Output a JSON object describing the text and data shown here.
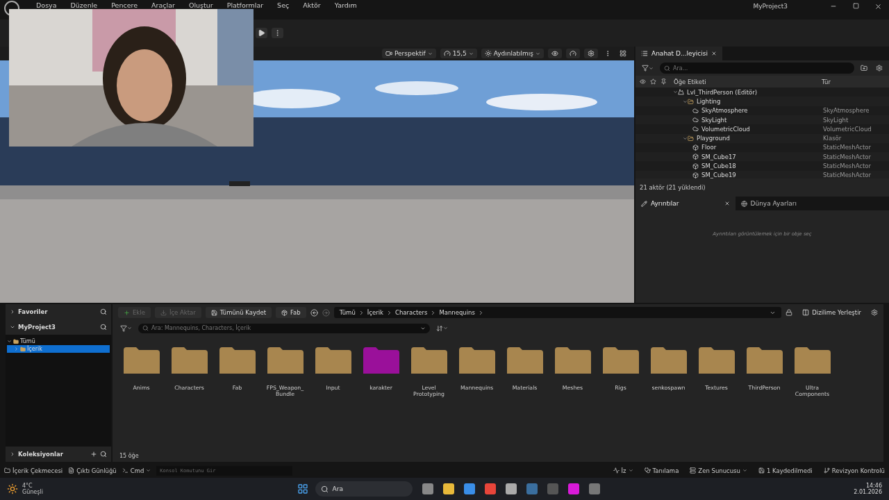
{
  "menu_bar": {
    "items": [
      "Dosya",
      "Düzenle",
      "Pencere",
      "Araçlar",
      "Oluştur",
      "Platformlar",
      "Seç",
      "Aktör",
      "Yardım"
    ],
    "project": "MyProject3"
  },
  "viewport": {
    "toolbar": [
      {
        "kind": "camera",
        "label": "Perspektif"
      },
      {
        "kind": "speed",
        "label": "15,5"
      },
      {
        "kind": "lit",
        "label": "Aydınlatılmış"
      }
    ]
  },
  "outliner": {
    "tab": {
      "label": "Anahat D...leyicisi",
      "selected": true
    },
    "search": {
      "placeholder": "Ara..."
    },
    "columns": [
      "Öğe Etiketi",
      "Tür"
    ],
    "tree": [
      {
        "label": "Lvl_ThirdPerson (Editör)",
        "kind": "level",
        "expanded": true,
        "children": [
          {
            "label": "Lighting",
            "kind": "folder",
            "expanded": true,
            "children": [
              {
                "label": "SkyAtmosphere",
                "kind": "actor",
                "type": "SkyAtmosphere"
              },
              {
                "label": "SkyLight",
                "kind": "actor",
                "type": "SkyLight"
              },
              {
                "label": "VolumetricCloud",
                "kind": "actor",
                "type": "VolumetricCloud"
              }
            ]
          },
          {
            "label": "Playground",
            "kind": "folder",
            "type": "Klasör",
            "expanded": true,
            "children": [
              {
                "label": "Floor",
                "kind": "mesh",
                "type": "StaticMeshActor"
              },
              {
                "label": "SM_Cube17",
                "kind": "mesh",
                "type": "StaticMeshActor"
              },
              {
                "label": "SM_Cube18",
                "kind": "mesh",
                "type": "StaticMeshActor"
              },
              {
                "label": "SM_Cube19",
                "kind": "mesh",
                "type": "StaticMeshActor"
              }
            ]
          }
        ]
      }
    ],
    "footer": "21 aktör (21 yüklendi)"
  },
  "details": {
    "tabs": [
      {
        "label": "Ayrıntılar",
        "selected": true
      },
      {
        "label": "Dünya Ayarları",
        "selected": false
      }
    ],
    "empty_message": "Ayrıntıları görüntülemek için bir obje seç"
  },
  "content_browser": {
    "sidebar": {
      "favorites": "Favoriler",
      "project": "MyProject3",
      "tree": [
        {
          "label": "Tümü",
          "selected": false,
          "children": [
            {
              "label": "İçerik",
              "selected": true
            }
          ]
        }
      ],
      "collections": "Koleksiyonlar"
    },
    "actions": [
      {
        "label": "Ekle",
        "kind": "add",
        "disabled": true
      },
      {
        "label": "İçe Aktar",
        "kind": "import",
        "disabled": true
      },
      {
        "label": "Tümünü Kaydet",
        "kind": "save",
        "disabled": false
      },
      {
        "label": "Fab",
        "kind": "fab",
        "disabled": false
      }
    ],
    "breadcrumb": [
      "Tümü",
      "İçerik",
      "Characters",
      "Mannequins"
    ],
    "dock_button": "Dizilime Yerleştir",
    "search": {
      "placeholder": "Ara: Mannequins, Characters, İçerik"
    },
    "folders": [
      {
        "name": "Anims",
        "color": "#a8864f"
      },
      {
        "name": "Characters",
        "color": "#a8864f"
      },
      {
        "name": "Fab",
        "color": "#a8864f"
      },
      {
        "name": "FPS_Weapon_ Bundle",
        "color": "#a8864f"
      },
      {
        "name": "Input",
        "color": "#a8864f"
      },
      {
        "name": "karakter",
        "color": "#9a109a"
      },
      {
        "name": "Level Prototyping",
        "color": "#a8864f"
      },
      {
        "name": "Mannequins",
        "color": "#a8864f"
      },
      {
        "name": "Materials",
        "color": "#a8864f"
      },
      {
        "name": "Meshes",
        "color": "#a8864f"
      },
      {
        "name": "Rigs",
        "color": "#a8864f"
      },
      {
        "name": "senkospawn",
        "color": "#a8864f"
      },
      {
        "name": "Textures",
        "color": "#a8864f"
      },
      {
        "name": "ThirdPerson",
        "color": "#a8864f"
      },
      {
        "name": "Ultra Components",
        "color": "#a8864f"
      }
    ],
    "count": "15 öğe"
  },
  "status_bar": {
    "left": [
      {
        "label": "İçerik Çekmecesi",
        "kind": "drawer"
      },
      {
        "label": "Çıktı Günlüğü",
        "kind": "log"
      },
      {
        "label": "Cmd",
        "kind": "cmd"
      }
    ],
    "console": {
      "placeholder": "Konsol Komutunu Gir"
    },
    "right": [
      {
        "label": "İz",
        "kind": "trace"
      },
      {
        "label": "Tanılama",
        "kind": "diag"
      },
      {
        "label": "Zen Sunucusu",
        "kind": "zen"
      },
      {
        "label": "1 Kaydedilmedi",
        "kind": "unsaved"
      },
      {
        "label": "Revizyon Kontrolü",
        "kind": "rev"
      }
    ]
  },
  "taskbar": {
    "weather": {
      "temp": "4°C",
      "condition": "Güneşli"
    },
    "search": {
      "placeholder": "Ara"
    },
    "time": "14:46",
    "date": "2.01.2026"
  }
}
